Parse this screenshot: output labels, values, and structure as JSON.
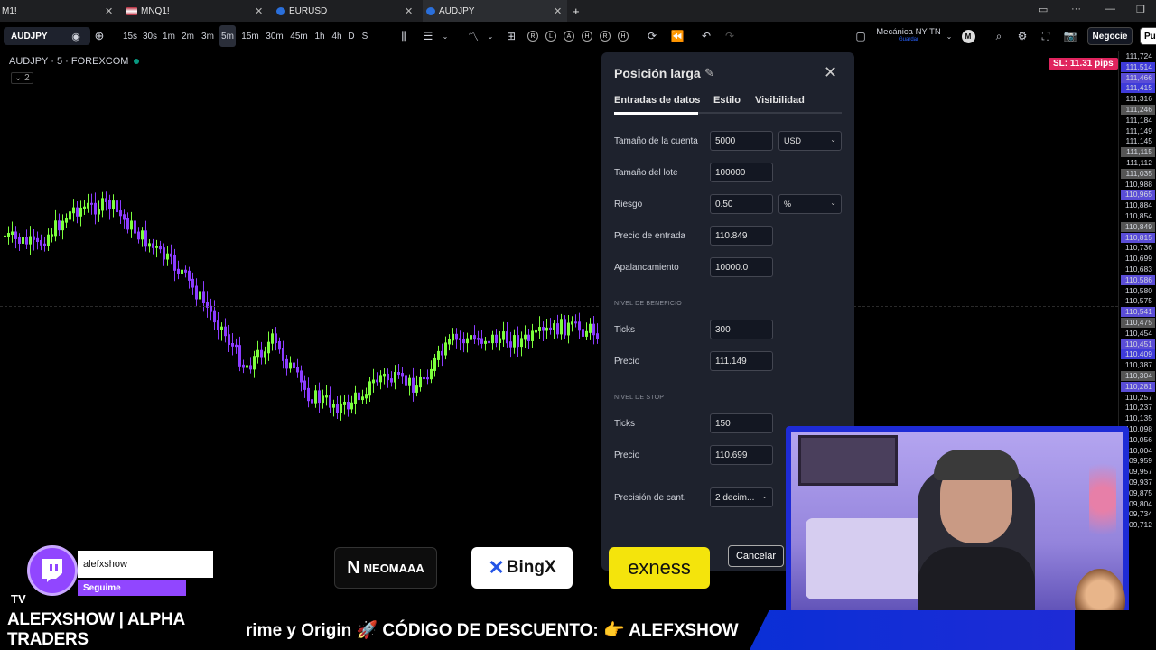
{
  "browser": {
    "tabs": [
      {
        "label": "M1!",
        "active": false
      },
      {
        "label": "MNQ1!",
        "active": false
      },
      {
        "label": "EURUSD",
        "active": false
      },
      {
        "label": "AUDJPY",
        "active": true
      }
    ],
    "new_tab": "+"
  },
  "toolbar": {
    "symbol": "AUDJPY",
    "timeframes": [
      "15s",
      "30s",
      "1m",
      "2m",
      "3m",
      "5m",
      "15m",
      "30m",
      "45m",
      "1h",
      "4h",
      "D",
      "S"
    ],
    "selected_timeframe": "5m",
    "letter_buttons": [
      "R",
      "L",
      "A",
      "H",
      "R",
      "H"
    ],
    "layout_name": "Mecánica NY TN",
    "layout_sub": "Guardar",
    "avatar_letter": "M",
    "trade_button": "Negocie",
    "publish_button": "Pu"
  },
  "chart": {
    "title": "AUDJPY · 5 · FOREXCOM",
    "collapse_label": "⌄ 2",
    "sl_badge": "SL: 11.31 pips",
    "price_labels": [
      {
        "v": "111,724",
        "h": false,
        "c": ""
      },
      {
        "v": "111,514",
        "h": true,
        "c": "#3f3bd9"
      },
      {
        "v": "111,466",
        "h": true,
        "c": "#5a4dd6"
      },
      {
        "v": "111,415",
        "h": true,
        "c": "#3f3bd9"
      },
      {
        "v": "111,316",
        "h": false,
        "c": ""
      },
      {
        "v": "111,246",
        "h": true,
        "c": "#555"
      },
      {
        "v": "111,184",
        "h": false,
        "c": ""
      },
      {
        "v": "111,149",
        "h": false,
        "c": ""
      },
      {
        "v": "111,145",
        "h": false,
        "c": ""
      },
      {
        "v": "111,115",
        "h": true,
        "c": "#555"
      },
      {
        "v": "111,112",
        "h": false,
        "c": ""
      },
      {
        "v": "111,035",
        "h": true,
        "c": "#555"
      },
      {
        "v": "110,988",
        "h": false,
        "c": ""
      },
      {
        "v": "110,965",
        "h": true,
        "c": "#5a4dd6"
      },
      {
        "v": "110,884",
        "h": false,
        "c": ""
      },
      {
        "v": "110,854",
        "h": false,
        "c": ""
      },
      {
        "v": "110,849",
        "h": true,
        "c": "#555"
      },
      {
        "v": "110,815",
        "h": true,
        "c": "#5a4dd6"
      },
      {
        "v": "110,736",
        "h": false,
        "c": ""
      },
      {
        "v": "110,699",
        "h": false,
        "c": ""
      },
      {
        "v": "110,683",
        "h": false,
        "c": ""
      },
      {
        "v": "110,586",
        "h": true,
        "c": "#5a4dd6"
      },
      {
        "v": "110,580",
        "h": false,
        "c": ""
      },
      {
        "v": "110,575",
        "h": false,
        "c": ""
      },
      {
        "v": "110,541",
        "h": true,
        "c": "#5a4dd6"
      },
      {
        "v": "110,475",
        "h": true,
        "c": "#555"
      },
      {
        "v": "110,454",
        "h": false,
        "c": ""
      },
      {
        "v": "110,451",
        "h": true,
        "c": "#5a4dd6"
      },
      {
        "v": "110,409",
        "h": true,
        "c": "#3f3bd9"
      },
      {
        "v": "110,387",
        "h": false,
        "c": ""
      },
      {
        "v": "110,304",
        "h": true,
        "c": "#555"
      },
      {
        "v": "110,281",
        "h": true,
        "c": "#5a4dd6"
      },
      {
        "v": "110,257",
        "h": false,
        "c": ""
      },
      {
        "v": "110,237",
        "h": false,
        "c": ""
      },
      {
        "v": "110,135",
        "h": false,
        "c": ""
      },
      {
        "v": "110,098",
        "h": false,
        "c": ""
      },
      {
        "v": "110,056",
        "h": false,
        "c": ""
      },
      {
        "v": "110,004",
        "h": false,
        "c": ""
      },
      {
        "v": "09,959",
        "h": false,
        "c": ""
      },
      {
        "v": "09,957",
        "h": false,
        "c": ""
      },
      {
        "v": "09,937",
        "h": false,
        "c": ""
      },
      {
        "v": "09,875",
        "h": false,
        "c": ""
      },
      {
        "v": "09,804",
        "h": false,
        "c": ""
      },
      {
        "v": "09,734",
        "h": false,
        "c": ""
      },
      {
        "v": "09,712",
        "h": false,
        "c": ""
      }
    ]
  },
  "dialog": {
    "title": "Posición larga",
    "tabs": [
      "Entradas de datos",
      "Estilo",
      "Visibilidad"
    ],
    "account_size_label": "Tamaño de la cuenta",
    "account_size": "5000",
    "currency": "USD",
    "lot_size_label": "Tamaño del lote",
    "lot_size": "100000",
    "risk_label": "Riesgo",
    "risk": "0.50",
    "risk_unit": "%",
    "entry_label": "Precio de entrada",
    "entry": "110.849",
    "leverage_label": "Apalancamiento",
    "leverage": "10000.0",
    "profit_section": "NIVEL DE BENEFICIO",
    "profit_ticks_label": "Ticks",
    "profit_ticks": "300",
    "profit_price_label": "Precio",
    "profit_price": "111.149",
    "stop_section": "NIVEL DE STOP",
    "stop_ticks_label": "Ticks",
    "stop_ticks": "150",
    "stop_price_label": "Precio",
    "stop_price": "110.699",
    "qty_precision_label": "Precisión de cant.",
    "qty_precision": "2 decim...",
    "cancel": "Cancelar"
  },
  "overlay": {
    "twitch_name": "alefxshow",
    "twitch_follow": "Seguime",
    "sponsors": [
      "NEOMAAA",
      "BingX",
      "exness"
    ],
    "ticker_brand": "ALEFXSHOW | ALPHA TRADERS",
    "ticker_text": "rime y Origin 🚀 CÓDIGO DE DESCUENTO: 👉 ALEFXSHOW",
    "tv_logo": "TV"
  },
  "colors": {
    "up_candle": "#7cff3c",
    "down_candle": "#8b3cff",
    "accent_purple": "#9146ff",
    "sl_badge": "#e0245e"
  }
}
